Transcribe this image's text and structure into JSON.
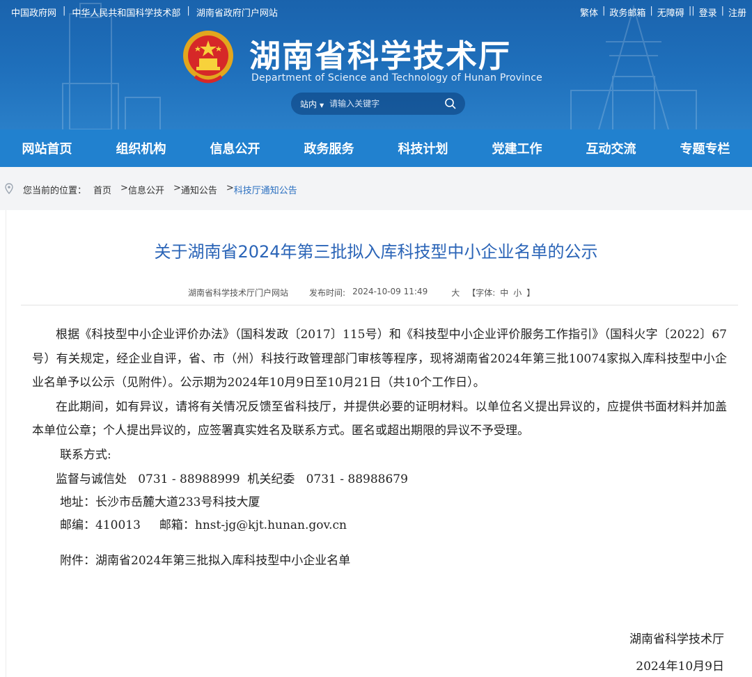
{
  "topbar": {
    "left_links": [
      "中国政府网",
      "中华人民共和国科学技术部",
      "湖南省政府门户网站"
    ],
    "right_links": [
      "繁体",
      "政务邮箱",
      "无障碍",
      "登录",
      "注册"
    ]
  },
  "header": {
    "title": "湖南省科学技术厅",
    "subtitle": "Department of Science and Technology of Hunan Province",
    "search": {
      "scope": "站内",
      "placeholder": "请输入关键字"
    }
  },
  "nav": {
    "items": [
      "网站首页",
      "组织机构",
      "信息公开",
      "政务服务",
      "科技计划",
      "党建工作",
      "互动交流",
      "专题专栏"
    ]
  },
  "breadcrumb": {
    "prefix": "您当前的位置：",
    "items": [
      "首页",
      "信息公开",
      "通知公告",
      "科技厅通知公告"
    ]
  },
  "article": {
    "title": "关于湖南省2024年第三批拟入库科技型中小企业名单的公示",
    "meta": {
      "source": "湖南省科学技术厅门户网站",
      "date_label": "发布时间:",
      "date": "2024-10-09 11:49",
      "size_large": "大",
      "font_label": "【字体:",
      "size_medium": "中",
      "size_small": "小",
      "font_close": "】"
    },
    "paragraphs": [
      "根据《科技型中小企业评价办法》（国科发政〔2017〕115号）和《科技型中小企业评价服务工作指引》（国科火字〔2022〕67号）有关规定，经企业自评，省、市（州）科技行政管理部门审核等程序，现将湖南省2024年第三批10074家拟入库科技型中小企业名单予以公示（见附件）。公示期为2024年10月9日至10月21日（共10个工作日）。",
      "在此期间，如有异议，请将有关情况反馈至省科技厅，并提供必要的证明材料。以单位名义提出异议的，应提供书面材料并加盖本单位公章；个人提出异议的，应签署真实姓名及联系方式。匿名或超出期限的异议不予受理。"
    ],
    "contact_label": "联系方式:",
    "contact_line": "监督与诚信处   0731 - 88988999  机关纪委   0731 - 88988679",
    "address": "地址：长沙市岳麓大道233号科技大厦",
    "postcode_email": "邮编：410013     邮箱：hnst-jg@kjt.hunan.gov.cn",
    "attachment": "附件：湖南省2024年第三批拟入库科技型中小企业名单",
    "signature_org": "湖南省科学技术厅",
    "signature_date": "2024年10月9日"
  },
  "colors": {
    "header_blue": "#1f70bc",
    "nav_blue": "#2181cf",
    "title_blue": "#2a64b7",
    "breadcrumb_bg": "#f3f4f6"
  },
  "icons": [
    "national-emblem-icon",
    "search-icon",
    "location-pin-icon"
  ]
}
